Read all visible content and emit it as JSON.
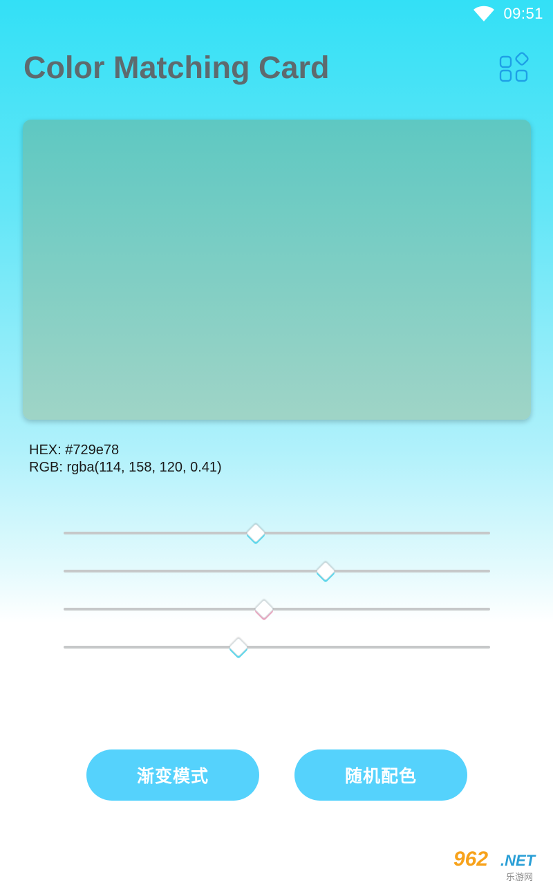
{
  "status_bar": {
    "time": "09:51",
    "wifi_icon": "wifi-icon"
  },
  "header": {
    "title": "Color Matching Card",
    "apps_icon": "apps-grid-icon"
  },
  "card": {
    "gradient_top": "#5ec8c2",
    "gradient_bottom": "#9fd4c6"
  },
  "color_info": {
    "hex_line": "HEX: #729e78",
    "rgb_line": "RGB: rgba(114, 158, 120, 0.41)"
  },
  "sliders": [
    {
      "name": "red",
      "value": 0.45,
      "thumb_style": "cyan"
    },
    {
      "name": "green",
      "value": 0.615,
      "thumb_style": "cyan"
    },
    {
      "name": "blue",
      "value": 0.47,
      "thumb_style": "pink"
    },
    {
      "name": "alpha",
      "value": 0.41,
      "thumb_style": "cyan"
    }
  ],
  "buttons": {
    "gradient_mode": "渐变模式",
    "random_color": "随机配色"
  },
  "watermark": {
    "number": "962",
    "suffix": ".NET",
    "subtitle": "乐游网"
  },
  "colors": {
    "accent": "#55d2fc",
    "title_text": "#5e6a6e",
    "icon_blue": "#1ea0e6"
  }
}
